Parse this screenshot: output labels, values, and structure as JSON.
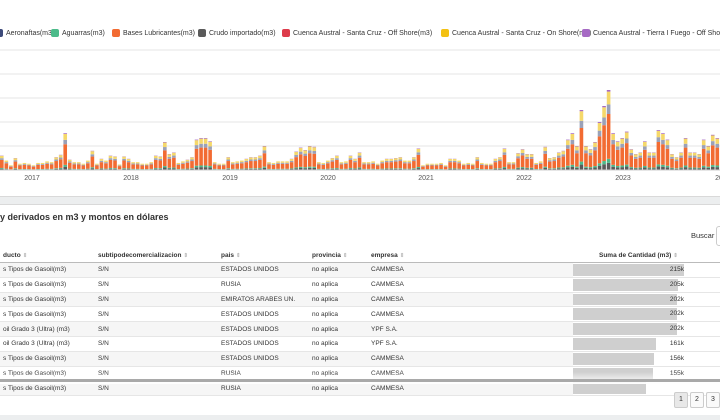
{
  "legend": [
    {
      "label": "Aeronaftas(m3)",
      "color": "#3d4a7a"
    },
    {
      "label": "Aguarras(m3)",
      "color": "#4cbb8a"
    },
    {
      "label": "Bases Lubricantes(m3)",
      "color": "#f26b32"
    },
    {
      "label": "Crudo importado(m3)",
      "color": "#5a5a5a"
    },
    {
      "label": "Cuenca Austral - Santa Cruz - Off Shore(m3)",
      "color": "#dd3b4b"
    },
    {
      "label": "Cuenca Austral - Santa Cruz - On  Shore(m3)",
      "color": "#f3c112"
    },
    {
      "label": "Cuenca Austral - Tierra I Fuego - Off Sho",
      "color": "#a66ac4"
    }
  ],
  "chart_data": {
    "type": "bar",
    "stacked": true,
    "x_tick_labels": [
      "2017",
      "2018",
      "2019",
      "2020",
      "2021",
      "2022",
      "2023",
      "20"
    ],
    "grid": true,
    "series": [
      {
        "name": "Aeronaftas(m3)",
        "color": "#3d4a7a"
      },
      {
        "name": "Aguarras(m3)",
        "color": "#4cbb8a"
      },
      {
        "name": "Bases Lubricantes(m3)",
        "color": "#f26b32"
      },
      {
        "name": "Crudo importado(m3)",
        "color": "#5a5a5a"
      },
      {
        "name": "Cuenca Austral - Santa Cruz - Off Shore(m3)",
        "color": "#dd3b4b"
      },
      {
        "name": "Cuenca Austral - Santa Cruz - On  Shore(m3)",
        "color": "#f3c112"
      },
      {
        "name": "Cuenca Austral - Tierra I Fuego - Off Sho",
        "color": "#a66ac4"
      }
    ],
    "stack_colors": [
      "#5a5a5a",
      "#4cbb8a",
      "#f26b32",
      "#9aa1b8",
      "#f5d86a",
      "#a66ac4"
    ],
    "bar_totals": [
      18,
      12,
      6,
      15,
      8,
      9,
      8,
      6,
      9,
      9,
      11,
      10,
      16,
      19,
      46,
      13,
      10,
      10,
      8,
      12,
      24,
      8,
      14,
      12,
      18,
      17,
      7,
      17,
      14,
      10,
      10,
      8,
      8,
      10,
      18,
      17,
      35,
      20,
      22,
      9,
      11,
      13,
      16,
      38,
      40,
      40,
      36,
      10,
      8,
      8,
      16,
      10,
      11,
      12,
      14,
      16,
      16,
      18,
      30,
      10,
      9,
      11,
      11,
      11,
      14,
      23,
      28,
      25,
      30,
      29,
      10,
      9,
      12,
      15,
      18,
      10,
      11,
      18,
      14,
      22,
      10,
      10,
      11,
      8,
      12,
      14,
      14,
      15,
      16,
      12,
      12,
      16,
      27,
      6,
      8,
      8,
      8,
      9,
      6,
      14,
      14,
      12,
      8,
      9,
      8,
      16,
      9,
      8,
      8,
      14,
      16,
      27,
      10,
      10,
      21,
      26,
      20,
      20,
      9,
      11,
      29,
      15,
      16,
      22,
      24,
      38,
      46,
      30,
      75,
      30,
      26,
      35,
      60,
      80,
      100,
      46,
      36,
      40,
      48,
      26,
      20,
      22,
      36,
      22,
      22,
      50,
      46,
      38,
      20,
      16,
      22,
      40,
      22,
      22,
      20,
      38,
      30,
      44,
      40
    ]
  },
  "section": {
    "title": "y derivados en m3 y montos en dólares"
  },
  "search": {
    "label": "Buscar",
    "placeholder": ""
  },
  "table": {
    "columns": [
      "ducto",
      "subtipodecomercializacion",
      "pais",
      "provincia",
      "empresa",
      "Suma de Cantidad (m3)"
    ],
    "rows": [
      {
        "producto": "s Tipos de Gasoil(m3)",
        "subtipo": "S/N",
        "pais": "ESTADOS UNIDOS",
        "provincia": "no aplica",
        "empresa": "CAMMESA",
        "cantidad": "215k",
        "pct": 100
      },
      {
        "producto": "s Tipos de Gasoil(m3)",
        "subtipo": "S/N",
        "pais": "RUSIA",
        "provincia": "no aplica",
        "empresa": "CAMMESA",
        "cantidad": "205k",
        "pct": 95
      },
      {
        "producto": "s Tipos de Gasoil(m3)",
        "subtipo": "S/N",
        "pais": "EMIRATOS ARABES UN.",
        "provincia": "no aplica",
        "empresa": "CAMMESA",
        "cantidad": "202k",
        "pct": 94
      },
      {
        "producto": "s Tipos de Gasoil(m3)",
        "subtipo": "S/N",
        "pais": "ESTADOS UNIDOS",
        "provincia": "no aplica",
        "empresa": "CAMMESA",
        "cantidad": "202k",
        "pct": 94
      },
      {
        "producto": "oil Grado 3 (Ultra) (m3)",
        "subtipo": "S/N",
        "pais": "ESTADOS UNIDOS",
        "provincia": "no aplica",
        "empresa": "YPF S.A.",
        "cantidad": "202k",
        "pct": 94
      },
      {
        "producto": "oil Grado 3 (Ultra) (m3)",
        "subtipo": "S/N",
        "pais": "ESTADOS UNIDOS",
        "provincia": "no aplica",
        "empresa": "YPF S.A.",
        "cantidad": "161k",
        "pct": 75
      },
      {
        "producto": "s Tipos de Gasoil(m3)",
        "subtipo": "S/N",
        "pais": "ESTADOS UNIDOS",
        "provincia": "no aplica",
        "empresa": "CAMMESA",
        "cantidad": "156k",
        "pct": 73
      },
      {
        "producto": "s Tipos de Gasoil(m3)",
        "subtipo": "S/N",
        "pais": "RUSIA",
        "provincia": "no aplica",
        "empresa": "CAMMESA",
        "cantidad": "155k",
        "pct": 72
      },
      {
        "producto": "s Tipos de Gasoil(m3)",
        "subtipo": "S/N",
        "pais": "RUSIA",
        "provincia": "no aplica",
        "empresa": "CAMMESA",
        "cantidad": "",
        "pct": 66
      }
    ]
  },
  "pagination": {
    "pages": [
      "1",
      "2",
      "3"
    ],
    "active": "1"
  }
}
